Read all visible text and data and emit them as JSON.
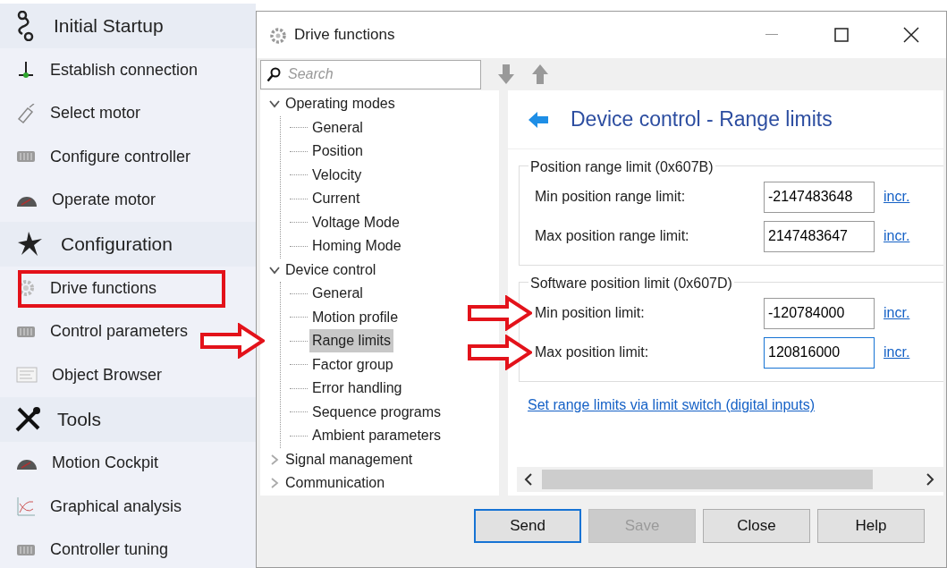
{
  "sidebar": {
    "sections": [
      {
        "title": "Initial Startup",
        "kind": "startup",
        "items": [
          {
            "label": "Establish connection",
            "kind": "connection",
            "highlighted": false
          },
          {
            "label": "Select motor",
            "kind": "motor",
            "highlighted": false
          },
          {
            "label": "Configure controller",
            "kind": "controller",
            "highlighted": false
          },
          {
            "label": "Operate motor",
            "kind": "gauge",
            "highlighted": false
          }
        ]
      },
      {
        "title": "Configuration",
        "kind": "config",
        "items": [
          {
            "label": "Drive functions",
            "kind": "gear",
            "highlighted": true
          },
          {
            "label": "Control parameters",
            "kind": "controller",
            "highlighted": false
          },
          {
            "label": "Object Browser",
            "kind": "browser",
            "highlighted": false
          }
        ]
      },
      {
        "title": "Tools",
        "kind": "tools",
        "items": [
          {
            "label": "Motion Cockpit",
            "kind": "gauge",
            "highlighted": false
          },
          {
            "label": "Graphical analysis",
            "kind": "chart",
            "highlighted": false
          },
          {
            "label": "Controller tuning",
            "kind": "controller",
            "highlighted": false
          }
        ]
      }
    ]
  },
  "dialog": {
    "title": "Drive functions",
    "search": {
      "placeholder": "Search"
    },
    "tree": [
      {
        "label": "Operating modes",
        "expanded": true,
        "children": [
          {
            "label": "General",
            "selected": false,
            "pointed": false
          },
          {
            "label": "Position",
            "selected": false,
            "pointed": false
          },
          {
            "label": "Velocity",
            "selected": false,
            "pointed": false
          },
          {
            "label": "Current",
            "selected": false,
            "pointed": false
          },
          {
            "label": "Voltage Mode",
            "selected": false,
            "pointed": false
          },
          {
            "label": "Homing Mode",
            "selected": false,
            "pointed": false
          }
        ]
      },
      {
        "label": "Device control",
        "expanded": true,
        "children": [
          {
            "label": "General",
            "selected": false,
            "pointed": false
          },
          {
            "label": "Motion profile",
            "selected": false,
            "pointed": false
          },
          {
            "label": "Range limits",
            "selected": true,
            "pointed": true
          },
          {
            "label": "Factor group",
            "selected": false,
            "pointed": false
          },
          {
            "label": "Error handling",
            "selected": false,
            "pointed": false
          },
          {
            "label": "Sequence programs",
            "selected": false,
            "pointed": false
          },
          {
            "label": "Ambient parameters",
            "selected": false,
            "pointed": false
          }
        ]
      },
      {
        "label": "Signal management",
        "expanded": false
      },
      {
        "label": "Communication",
        "expanded": false
      }
    ],
    "heading": "Device control - Range limits",
    "groups": [
      {
        "title": "Position range limit (0x607B)",
        "fields": [
          {
            "label": "Min position range limit:",
            "value": "-2147483648",
            "unit": "incr.",
            "focused": false,
            "pointed": false
          },
          {
            "label": "Max position range limit:",
            "value": "2147483647",
            "unit": "incr.",
            "focused": false,
            "pointed": false
          }
        ]
      },
      {
        "title": "Software position limit (0x607D)",
        "fields": [
          {
            "label": "Min position limit:",
            "value": "-120784000",
            "unit": "incr.",
            "focused": false,
            "pointed": true
          },
          {
            "label": "Max position limit:",
            "value": "120816000",
            "unit": "incr.",
            "focused": true,
            "pointed": true
          }
        ]
      }
    ],
    "link": "Set range limits via limit switch (digital inputs)",
    "buttons": [
      {
        "label": "Send",
        "default": true,
        "disabled": false
      },
      {
        "label": "Save",
        "default": false,
        "disabled": true
      },
      {
        "label": "Close",
        "default": false,
        "disabled": false
      },
      {
        "label": "Help",
        "default": false,
        "disabled": false
      }
    ]
  }
}
